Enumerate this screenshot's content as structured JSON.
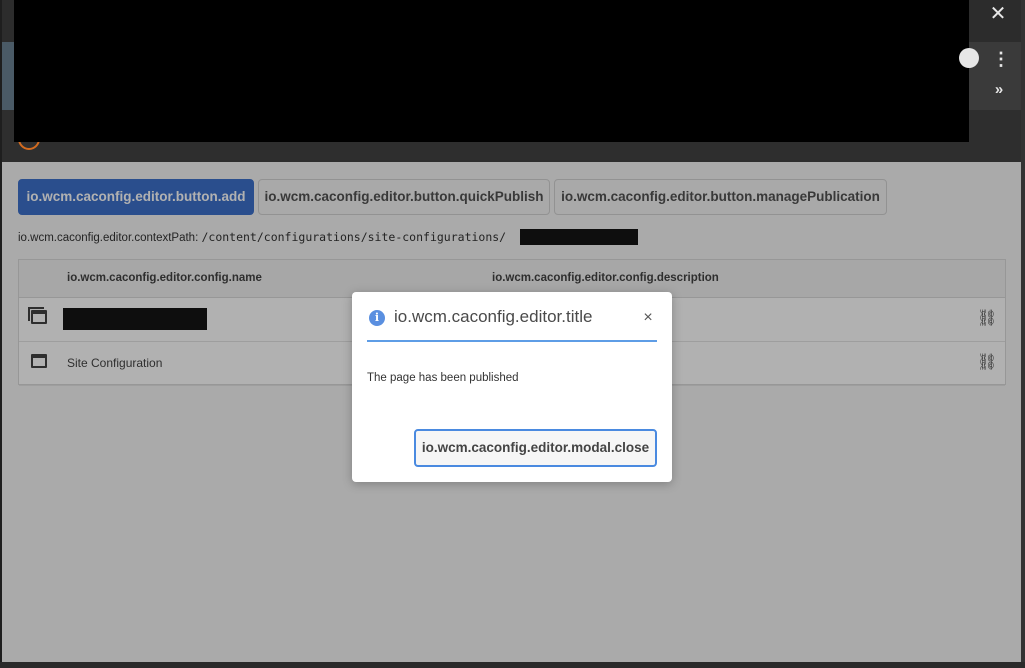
{
  "window": {
    "close_glyph": "✕",
    "kebab_glyph": "⋮",
    "chevrons_glyph": "»"
  },
  "toolbar": {
    "add_label": "io.wcm.caconfig.editor.button.add",
    "quick_publish_label": "io.wcm.caconfig.editor.button.quickPublish",
    "manage_publication_label": "io.wcm.caconfig.editor.button.managePublication"
  },
  "context": {
    "label": "io.wcm.caconfig.editor.contextPath:",
    "path": "/content/configurations/site-configurations/"
  },
  "table": {
    "headers": {
      "name": "io.wcm.caconfig.editor.config.name",
      "description": "io.wcm.caconfig.editor.config.description"
    },
    "rows": [
      {
        "name": "",
        "redacted": true
      },
      {
        "name": "Site Configuration",
        "redacted": false
      }
    ],
    "link_glyph": "⛓"
  },
  "modal": {
    "info_glyph": "i",
    "title": "io.wcm.caconfig.editor.title",
    "close_glyph": "×",
    "message": "The page has been published",
    "close_button_label": "io.wcm.caconfig.editor.modal.close"
  },
  "colors": {
    "primary": "#2d65c7",
    "modal_accent": "#5e9de6",
    "brand_orange": "#d46b1f"
  }
}
